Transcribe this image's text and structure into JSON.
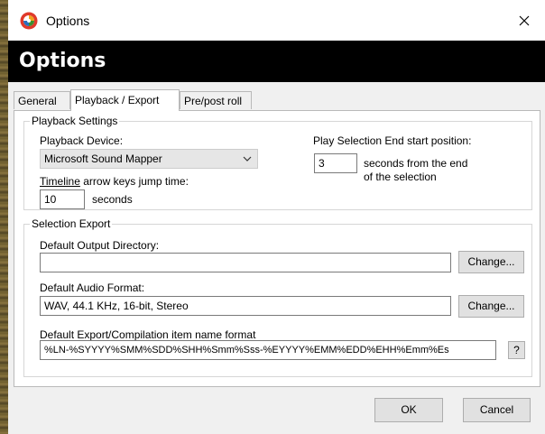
{
  "window": {
    "title": "Options",
    "close_glyph": "✕",
    "icon": "app-logo-icon",
    "accent_color": "#e03a2b"
  },
  "header": {
    "title": "Options"
  },
  "tabs": [
    {
      "label": "General",
      "active": false
    },
    {
      "label": "Playback / Export",
      "active": true
    },
    {
      "label": "Pre/post roll",
      "active": false
    }
  ],
  "playback": {
    "group_title": "Playback Settings",
    "device_label": "Playback Device:",
    "device_value": "Microsoft Sound Mapper",
    "arrow_label_underlined": "Timeline",
    "arrow_label_rest": " arrow keys jump time:",
    "arrow_value": "10",
    "arrow_unit": "seconds",
    "end_label": "Play Selection End start position:",
    "end_value": "3",
    "end_suffix_line1": "seconds from the end",
    "end_suffix_line2": "of the selection"
  },
  "export": {
    "group_title": "Selection Export",
    "output_dir_label": "Default Output Directory:",
    "output_dir_value": "",
    "change_label": "Change...",
    "audio_format_label": "Default Audio Format:",
    "audio_format_value": "WAV, 44.1 KHz, 16-bit, Stereo",
    "name_format_label": "Default Export/Compilation item name format",
    "name_format_value": "%LN-%SYYYY%SMM%SDD%SHH%Smm%Sss-%EYYYY%EMM%EDD%EHH%Emm%Es",
    "help_label": "?"
  },
  "footer": {
    "ok_label": "OK",
    "cancel_label": "Cancel"
  }
}
